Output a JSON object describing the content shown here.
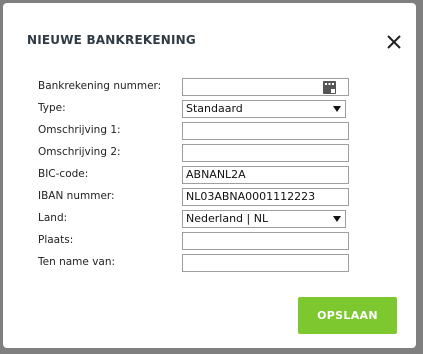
{
  "dialog": {
    "title": "NIEUWE BANKREKENING",
    "close_icon": "close-icon",
    "fields": {
      "bankrekening_label": "Bankrekening nummer:",
      "bankrekening_value": "",
      "type_label": "Type:",
      "type_value": "Standaard",
      "omschrijving1_label": "Omschrijving 1:",
      "omschrijving1_value": "",
      "omschrijving2_label": "Omschrijving 2:",
      "omschrijving2_value": "",
      "bic_label": "BIC-code:",
      "bic_value": "ABNANL2A",
      "iban_label": "IBAN nummer:",
      "iban_value": "NL03ABNA0001112223",
      "land_label": "Land:",
      "land_value": "Nederland | NL",
      "plaats_label": "Plaats:",
      "plaats_value": "",
      "tenname_label": "Ten name van:",
      "tenname_value": ""
    },
    "save_label": "OPSLAAN"
  },
  "colors": {
    "accent": "#7dc82e",
    "overlay": "#7f7f7f"
  }
}
